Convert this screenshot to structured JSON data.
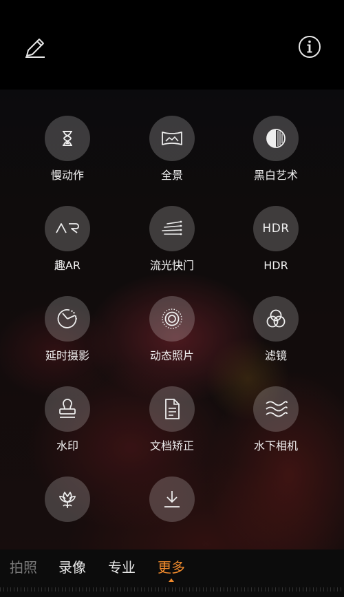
{
  "top_bar": {
    "edit_icon": "pencil-icon",
    "info_icon": "info-icon"
  },
  "modes": [
    {
      "label": "慢动作",
      "icon": "hourglass-icon"
    },
    {
      "label": "全景",
      "icon": "panorama-icon"
    },
    {
      "label": "黑白艺术",
      "icon": "monochrome-icon"
    },
    {
      "label": "趣AR",
      "icon": "ar-icon",
      "icon_text": "AR"
    },
    {
      "label": "流光快门",
      "icon": "light-trails-icon"
    },
    {
      "label": "HDR",
      "icon": "hdr-icon",
      "icon_text": "HDR"
    },
    {
      "label": "延时摄影",
      "icon": "timelapse-icon"
    },
    {
      "label": "动态照片",
      "icon": "moving-picture-icon"
    },
    {
      "label": "滤镜",
      "icon": "filter-icon"
    },
    {
      "label": "水印",
      "icon": "stamp-icon"
    },
    {
      "label": "文档矫正",
      "icon": "document-icon"
    },
    {
      "label": "水下相机",
      "icon": "waves-icon"
    },
    {
      "label": "",
      "icon": "flower-icon"
    },
    {
      "label": "",
      "icon": "download-icon"
    }
  ],
  "bottom_tabs": {
    "items": [
      "拍照",
      "录像",
      "专业",
      "更多"
    ],
    "active": "更多",
    "accent_color": "#f08a2c"
  }
}
